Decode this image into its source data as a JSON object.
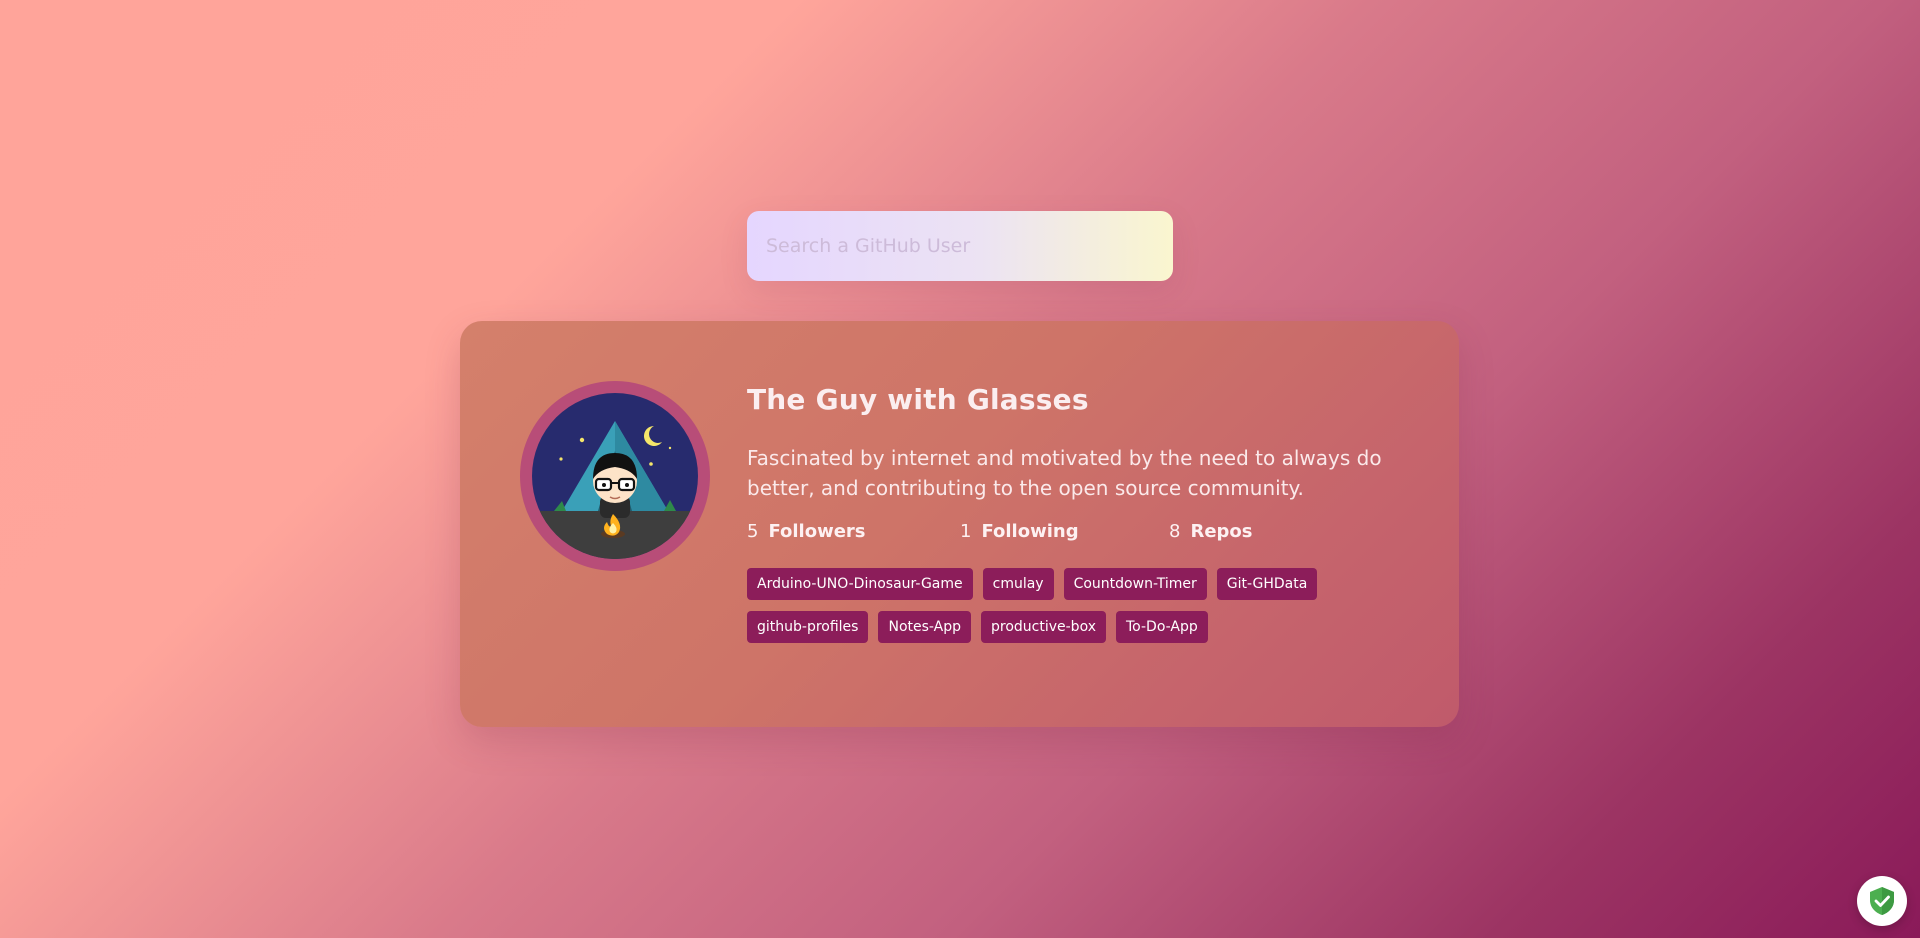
{
  "search": {
    "placeholder": "Search a GitHub User",
    "value": ""
  },
  "profile": {
    "avatar_icon": "camping-guy-with-glasses-avatar",
    "name": "The Guy with Glasses",
    "bio": "Fascinated by internet and motivated by the need to always do better, and contributing to the open source community.",
    "stats": {
      "followers_count": "5",
      "followers_label": "Followers",
      "following_count": "1",
      "following_label": "Following",
      "repos_count": "8",
      "repos_label": "Repos"
    },
    "repos": [
      "Arduino-UNO-Dinosaur-Game",
      "cmulay",
      "Countdown-Timer",
      "Git-GHData",
      "github-profiles",
      "Notes-App",
      "productive-box",
      "To-Do-App"
    ]
  },
  "badge": {
    "icon": "shield-check-icon"
  },
  "colors": {
    "repo_tag_bg": "#8c1d5a",
    "card_bg": "#d07a6a",
    "avatar_ring": "#b84d78",
    "badge_green": "#4caf50"
  }
}
